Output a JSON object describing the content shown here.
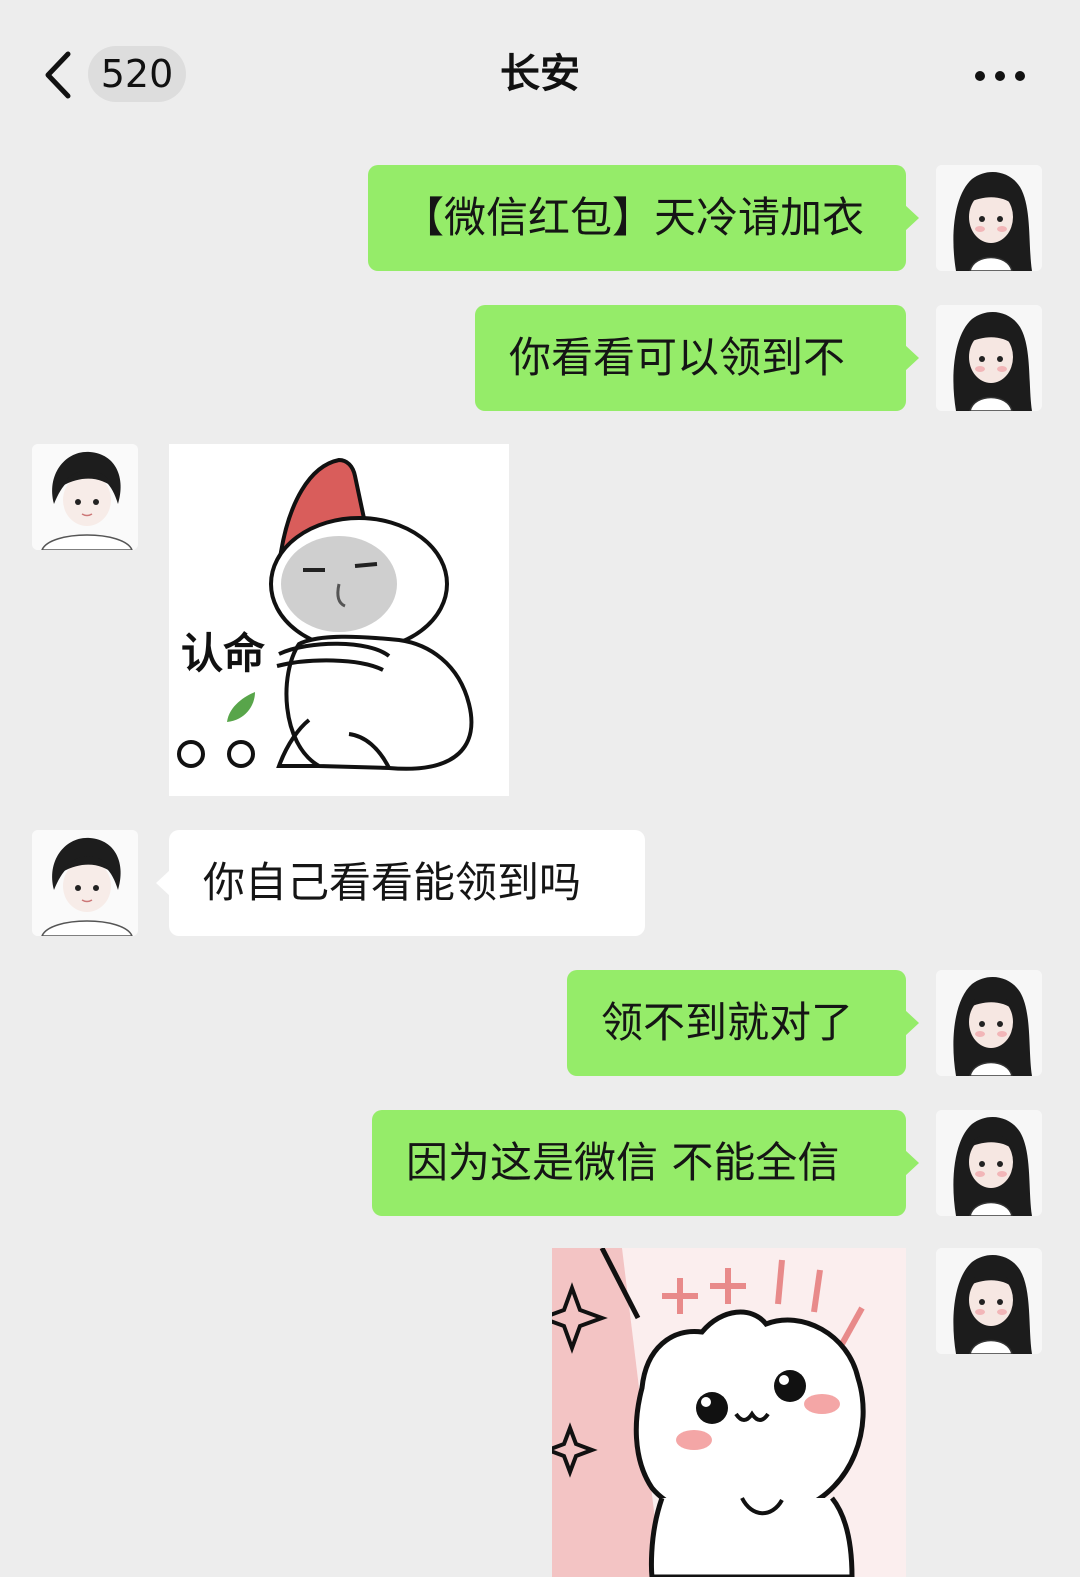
{
  "header": {
    "back_icon": "chevron-left-icon",
    "unread_count": "520",
    "title": "长安",
    "more_icon": "more-dots-icon"
  },
  "messages": [
    {
      "sender": "me",
      "type": "text",
      "text": "【微信红包】天冷请加衣"
    },
    {
      "sender": "me",
      "type": "text",
      "text": "你看看可以领到不"
    },
    {
      "sender": "other",
      "type": "sticker",
      "caption": "认命"
    },
    {
      "sender": "other",
      "type": "text",
      "text": "你自己看看能领到吗"
    },
    {
      "sender": "me",
      "type": "text",
      "text": "领不到就对了"
    },
    {
      "sender": "me",
      "type": "text",
      "text": "因为这是微信 不能全信"
    },
    {
      "sender": "me",
      "type": "sticker",
      "caption": ""
    }
  ],
  "colors": {
    "background": "#ededed",
    "my_bubble": "#95ec69",
    "their_bubble": "#ffffff"
  }
}
